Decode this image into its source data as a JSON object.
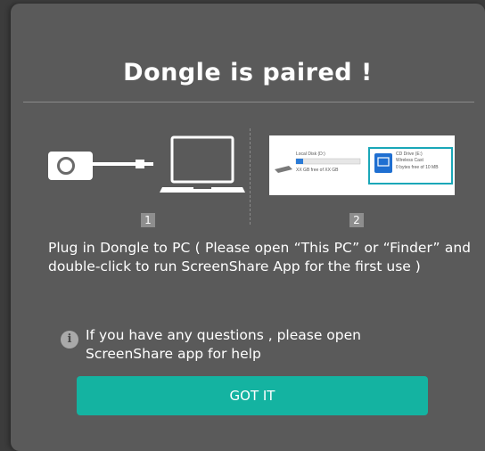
{
  "dialog": {
    "title": "Dongle is paired !",
    "steps": [
      {
        "number": "1",
        "icons": [
          "dongle-icon",
          "laptop-icon"
        ]
      },
      {
        "number": "2",
        "explorer": {
          "local_disk_name": "Local Disk (D:)",
          "local_disk_free": "XX GB free of XX GB",
          "cd_drive_name": "CD Drive (E:)",
          "cd_drive_label": "Wireless Cast",
          "cd_drive_free": "0 bytes free of 10 MB"
        }
      }
    ],
    "instruction": "Plug in Dongle to PC ( Please open “This PC” or “Finder” and double-click to run ScreenShare App for the first use )",
    "info_text": "If you have any questions , please open ScreenShare app for help",
    "button_label": "GOT IT",
    "colors": {
      "background": "#5a5a5a",
      "accent": "#14b3a1",
      "highlight_border": "#1aa7b8"
    }
  }
}
